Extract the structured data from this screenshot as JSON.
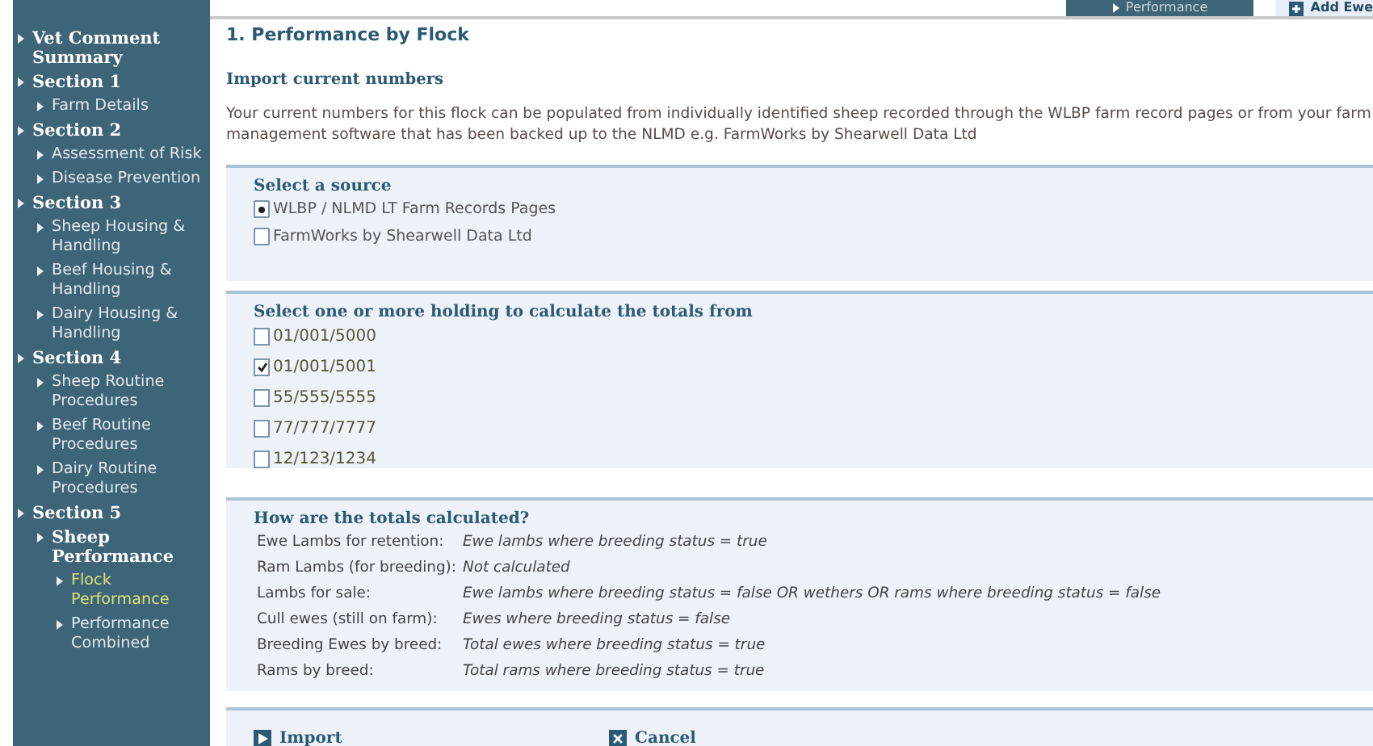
{
  "top_buttons": [
    {
      "label": "Performance",
      "kind": "tab"
    },
    {
      "label": "Add Ewe",
      "kind": "add"
    }
  ],
  "sidebar": {
    "items": [
      {
        "label": "Vet Comment Summary",
        "selected": false
      },
      {
        "label": "Section 1",
        "selected": false,
        "children": [
          {
            "label": "Farm Details",
            "selected": false
          }
        ]
      },
      {
        "label": "Section 2",
        "selected": false,
        "children": [
          {
            "label": "Assessment of Risk",
            "selected": false
          },
          {
            "label": "Disease Prevention",
            "selected": false
          }
        ]
      },
      {
        "label": "Section 3",
        "selected": false,
        "children": [
          {
            "label": "Sheep Housing & Handling",
            "selected": false
          },
          {
            "label": "Beef Housing & Handling",
            "selected": false
          },
          {
            "label": "Dairy Housing & Handling",
            "selected": false
          }
        ]
      },
      {
        "label": "Section 4",
        "selected": false,
        "children": [
          {
            "label": "Sheep Routine Procedures",
            "selected": false
          },
          {
            "label": "Beef Routine Procedures",
            "selected": false
          },
          {
            "label": "Dairy Routine Procedures",
            "selected": false
          }
        ]
      },
      {
        "label": "Section 5",
        "selected": false,
        "children": [
          {
            "label": "Sheep Performance",
            "selected": false,
            "children": [
              {
                "label": "Flock Performance",
                "selected": true
              },
              {
                "label": "Performance Combined",
                "selected": false
              }
            ]
          }
        ]
      }
    ]
  },
  "title": "1. Performance by Flock",
  "subtitle": "Import current numbers",
  "intro": "Your current numbers for this flock can be populated from individually identified sheep recorded through the WLBP farm record pages or from your farm management software that has been backed up to the NLMD e.g. FarmWorks by Shearwell Data Ltd",
  "source": {
    "title": "Select a source",
    "options": [
      {
        "label": "WLBP / NLMD LT Farm Records Pages",
        "selected": true
      },
      {
        "label": "FarmWorks by Shearwell Data Ltd",
        "selected": false
      }
    ]
  },
  "holdings": {
    "title": "Select one or more holding to calculate the totals from",
    "items": [
      {
        "label": "01/001/5000",
        "checked": false
      },
      {
        "label": "01/001/5001",
        "checked": true
      },
      {
        "label": "55/555/5555",
        "checked": false
      },
      {
        "label": "77/777/7777",
        "checked": false
      },
      {
        "label": "12/123/1234",
        "checked": false
      }
    ]
  },
  "totals": {
    "title": "How are the totals calculated?",
    "rows": [
      {
        "label": "Ewe Lambs for retention:",
        "value": "Ewe lambs where breeding status = true"
      },
      {
        "label": "Ram Lambs (for breeding):",
        "value": "Not calculated"
      },
      {
        "label": "Lambs for sale:",
        "value": "Ewe lambs where breeding status = false OR wethers OR rams where breeding status = false"
      },
      {
        "label": "Cull ewes (still on farm):",
        "value": "Ewes where breeding status = false"
      },
      {
        "label": "Breeding Ewes by breed:",
        "value": "Total ewes where breeding status = true"
      },
      {
        "label": "Rams by breed:",
        "value": "Total rams where breeding status = true"
      }
    ]
  },
  "actions": [
    {
      "label": "Import",
      "kind": "import"
    },
    {
      "label": "Cancel",
      "kind": "cancel"
    }
  ]
}
